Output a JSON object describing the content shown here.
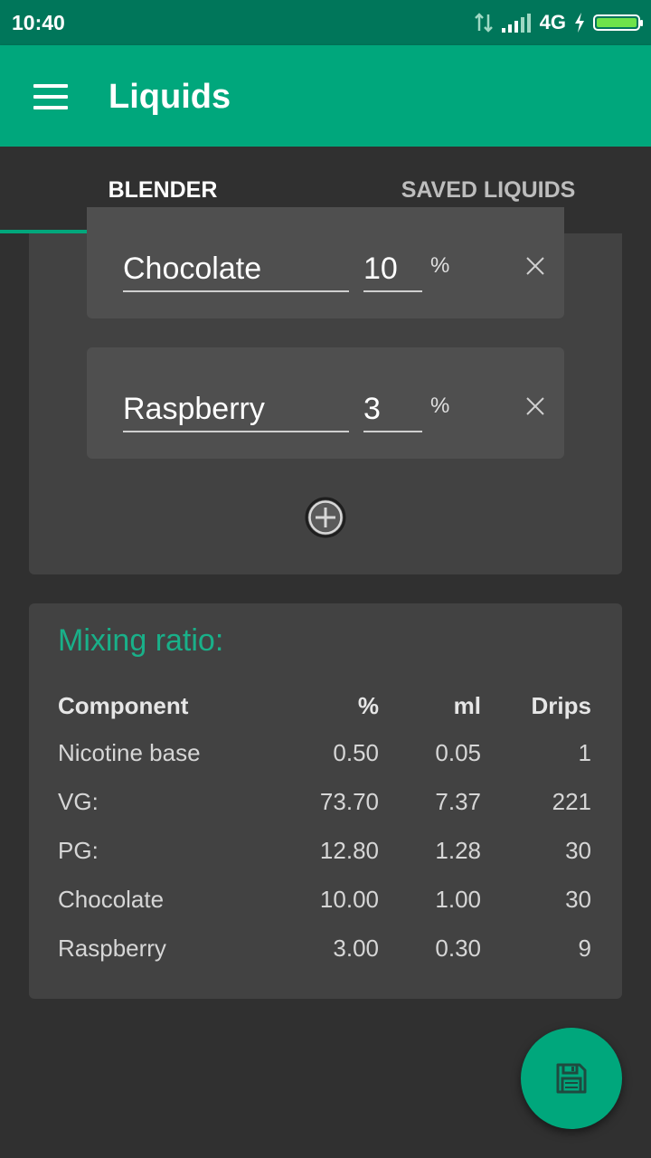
{
  "status_bar": {
    "time": "10:40",
    "network": "4G"
  },
  "app_bar": {
    "title": "Liquids"
  },
  "tabs": [
    {
      "label": "BLENDER",
      "active": true
    },
    {
      "label": "SAVED LIQUIDS",
      "active": false
    }
  ],
  "flavors": [
    {
      "name": "Chocolate",
      "percent": "10",
      "unit": "%"
    },
    {
      "name": "Raspberry",
      "percent": "3",
      "unit": "%"
    }
  ],
  "mixing": {
    "title": "Mixing ratio:",
    "headers": {
      "component": "Component",
      "percent": "%",
      "ml": "ml",
      "drips": "Drips"
    },
    "rows": [
      {
        "component": "Nicotine base",
        "percent": "0.50",
        "ml": "0.05",
        "drips": "1"
      },
      {
        "component": "VG:",
        "percent": "73.70",
        "ml": "7.37",
        "drips": "221"
      },
      {
        "component": "PG:",
        "percent": "12.80",
        "ml": "1.28",
        "drips": "30"
      },
      {
        "component": "Chocolate",
        "percent": "10.00",
        "ml": "1.00",
        "drips": "30"
      },
      {
        "component": "Raspberry",
        "percent": "3.00",
        "ml": "0.30",
        "drips": "9"
      }
    ]
  },
  "icons": {
    "menu": "menu-icon",
    "remove": "close-icon",
    "add": "add-circle-icon",
    "save": "save-icon"
  },
  "colors": {
    "primary": "#00a77c",
    "primary_dark": "#00765a",
    "accent_text": "#19b089",
    "background": "#303030",
    "card": "#424242"
  }
}
